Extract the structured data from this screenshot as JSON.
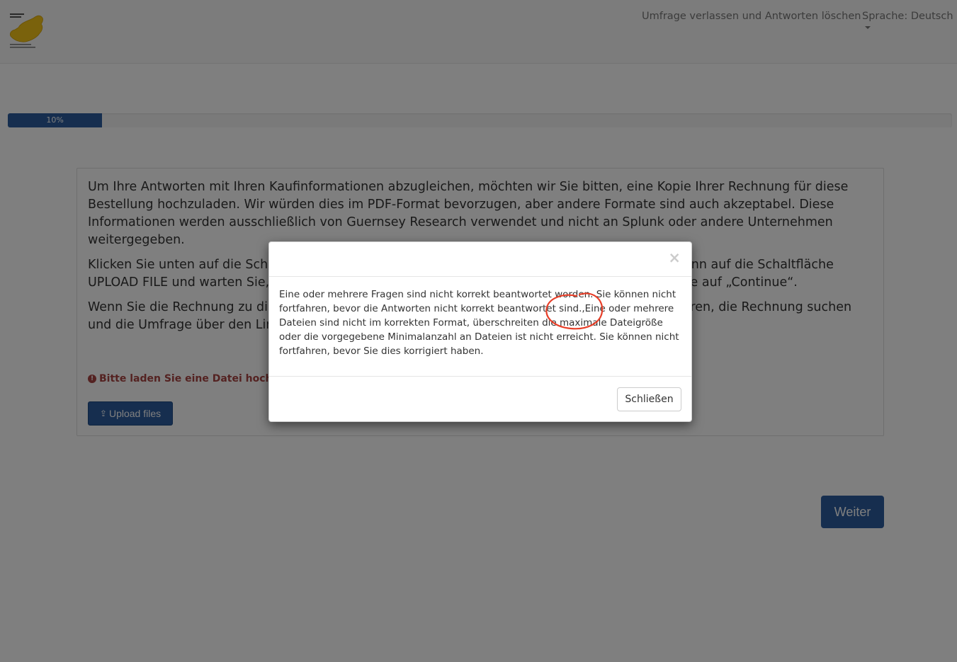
{
  "navbar": {
    "exit_label": "Umfrage verlassen und Antworten löschen",
    "language_label": "Sprache: Deutsch"
  },
  "progress": {
    "label": "10%",
    "value": 10
  },
  "question": {
    "paragraphs": [
      "Um Ihre Antworten mit Ihren Kaufinformationen abzugleichen, möchten wir Sie bitten, eine Kopie Ihrer Rechnung für diese Bestel­lung hochzuladen. Wir würden dies im PDF-Format bevorzugen, aber andere Formate sind auch akzeptabel. Diese Informationen werden ausschließlich von Guernsey Research verwendet und nicht an Splunk oder andere Unternehmen weitergegeben.",
      "Klicken Sie unten auf die Schaltfläche UPLOAD FILES, wählen Sie die Datei aus und klicken Sie dann auf die Schaltflä­che UPLOAD FILE und warten Sie, bis der Upload abgeschlossen ist. Nach dem Upload klicken Sie bitte auf „Continue“.",
      "Wenn Sie die Rechnung zu diesem Zeitpunkt nicht zur Hand haben, können Sie später zurückkehren, die Rechnung suchen und die Umfrage über den Link in Ihrer E-Mail fortsetzen."
    ],
    "error": "Bitte laden Sie eine Datei hoch.",
    "upload_label": "Upload files"
  },
  "next_label": "Weiter",
  "modal": {
    "close_symbol": "×",
    "message": "Eine oder mehrere Fragen sind nicht korrekt beantwortet worden. Sie können nicht fortfahren, bevor die Antworten nicht korrekt beantwortet sind.,Eine oder mehrere Dateien sind nicht im korrekten Format, überschreiten die maximale Dateigröße oder die vorgegebene Minimalanzahl an Dateien ist nicht erreicht. Sie können nicht fortfahren, bevor Sie dies korrigiert haben.",
    "button_label": "Schließen"
  },
  "colors": {
    "primary": "#2c5d9e",
    "error": "#a94442",
    "annotation": "#e8402a",
    "logo": "#f5c518"
  },
  "icons": [
    "logo-icon",
    "caret-down-icon",
    "exclamation-circle-icon",
    "upload-icon",
    "close-icon"
  ]
}
